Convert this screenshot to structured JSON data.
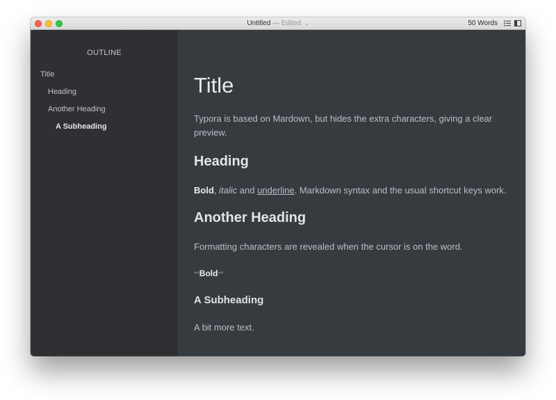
{
  "window": {
    "title": "Untitled",
    "separator": "—",
    "status": "Edited",
    "word_count": "50 Words"
  },
  "icons": {
    "close": "close-traffic-light",
    "minimize": "minimize-traffic-light",
    "maximize": "maximize-traffic-light",
    "title_menu": "chevron-down-icon",
    "outline_toggle": "outline-list-icon",
    "sidebar_toggle": "sidebar-panel-icon"
  },
  "colors": {
    "editor_bg": "#363b40",
    "sidebar_bg": "#2e3033",
    "text": "#b8bfc6",
    "heading": "#e8e8e8"
  },
  "sidebar": {
    "header": "OUTLINE",
    "items": [
      {
        "label": "Title",
        "level": 1,
        "active": false
      },
      {
        "label": "Heading",
        "level": 2,
        "active": false
      },
      {
        "label": "Another Heading",
        "level": 2,
        "active": false
      },
      {
        "label": "A Subheading",
        "level": 3,
        "active": true
      }
    ]
  },
  "document": {
    "title": "Title",
    "intro": "Typora is based on Mardown, but hides the extra characters, giving a clear preview.",
    "heading1": "Heading",
    "bold": "Bold",
    "comma": ",",
    "italic": "italic",
    "and": "and",
    "underline": "underline",
    "formatting_rest": ". Markdown syntax and the usual shortcut keys work.",
    "heading2": "Another Heading",
    "reveal_text": "Formatting characters are revealed when the cursor is on the word.",
    "md_marker": "**",
    "revealed_bold": "Bold",
    "subheading": "A Subheading",
    "closing": "A bit more text."
  }
}
